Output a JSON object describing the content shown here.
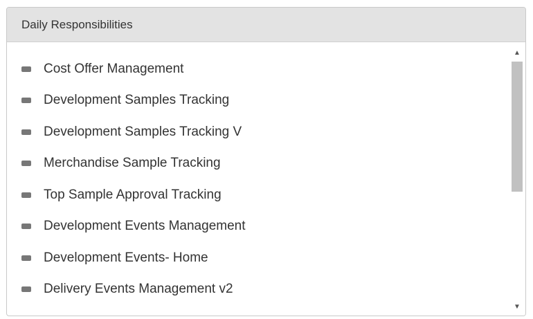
{
  "panel": {
    "title": "Daily Responsibilities"
  },
  "list": {
    "items": [
      {
        "label": "Cost Offer Management",
        "icon": "bullet-icon"
      },
      {
        "label": "Development Samples Tracking",
        "icon": "bullet-icon"
      },
      {
        "label": "Development Samples Tracking V",
        "icon": "bullet-icon"
      },
      {
        "label": "Merchandise Sample Tracking",
        "icon": "bullet-icon"
      },
      {
        "label": "Top Sample Approval Tracking",
        "icon": "bullet-icon"
      },
      {
        "label": "Development Events Management",
        "icon": "bullet-icon"
      },
      {
        "label": "Development Events- Home",
        "icon": "bullet-icon"
      },
      {
        "label": "Delivery Events Management v2",
        "icon": "bullet-icon"
      }
    ]
  },
  "scrollbar": {
    "up_glyph": "▲",
    "down_glyph": "▼",
    "thumb_color": "#c1c1c1"
  },
  "colors": {
    "header_bg": "#e3e3e3",
    "border": "#c9c9c9",
    "text": "#333333",
    "bullet": "#777777"
  }
}
